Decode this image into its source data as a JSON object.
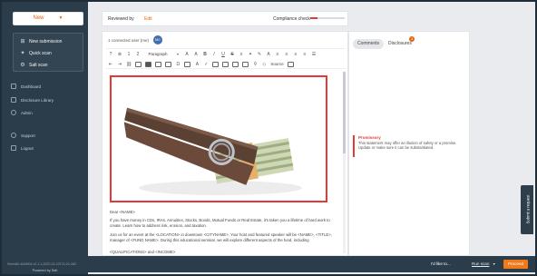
{
  "sidebar": {
    "new_label": "New",
    "group": [
      {
        "label": "New submission",
        "icon": "plus-square-icon"
      },
      {
        "label": "Quick scan",
        "icon": "lightbulb-icon"
      },
      {
        "label": "Salt scan",
        "icon": "salt-scan-icon"
      }
    ],
    "nav": [
      {
        "label": "Dashboard",
        "icon": "dashboard-icon"
      },
      {
        "label": "Disclosure Library",
        "icon": "library-icon"
      },
      {
        "label": "Admin",
        "icon": "admin-icon"
      },
      {
        "label": "Support",
        "icon": "support-icon"
      },
      {
        "label": "Logout",
        "icon": "logout-icon"
      }
    ],
    "version": "ShieldEr.4645f04.v2.1.1-2022-03-23T21:21:28Z",
    "powered": "Powered by Salt"
  },
  "topbar": {
    "reviewed_by": "Reviewed by",
    "edit": "Edit",
    "compliance": "Compliance check",
    "compliance_level_pct": 20
  },
  "editor": {
    "users": "1 connected user (me)",
    "avatar": "MC",
    "toolbar_row1": [
      "?",
      "⊕",
      "1",
      "?",
      "2",
      "Paragraph",
      "A",
      "A",
      "B",
      "I",
      "U",
      "S",
      "x",
      "⊕",
      "A",
      "¶",
      "≡",
      "≡",
      "≡",
      "≡",
      "⇥"
    ],
    "toolbar_row2": [
      "⇤",
      "↵",
      "⛓",
      "⊟",
      "▣",
      "▦",
      "⊞",
      "☷",
      "▭",
      "A",
      "✓",
      "⊟",
      "▭",
      "▤",
      "▦",
      "⊕",
      "Source",
      "▣"
    ],
    "paragraph_label": "Paragraph",
    "source_label": "Source",
    "greeting": "Dear <NAME>",
    "para1": "If you have money in CDs, IRAs, Annuities, Stocks, Bonds, Mutual Funds or Real Estate, it's taken you a lifetime of hard work to create. Learn how to address risk, erosion, and taxation.",
    "para2": "Join us for an event at the <LOCATION> in downtown <CITYNAME>. Your host and featured speaker will be <NAME>, <TITLE>, manager of <FUND NAME>. During this educational seminar, we will explore different aspects of the fund, including",
    "para3": "<QUALIFICATIONS> and <INCOME>"
  },
  "rpanel": {
    "tab_comments": "Comments",
    "tab_disclosures": "Disclosures",
    "badge": "3",
    "flag_title": "Promissory",
    "flag_text": "This statement may offer an illusion of safety or a promise. Update or make sure it can be substantiated."
  },
  "submit_request": "Submit a request",
  "bottombar": {
    "like_to": "I'd like to...",
    "run_scan": "Run scan",
    "proceed": "Proceed"
  },
  "colors": {
    "accent": "#e8650f",
    "sidebar": "#2b3c4a",
    "flag": "#e53935"
  }
}
